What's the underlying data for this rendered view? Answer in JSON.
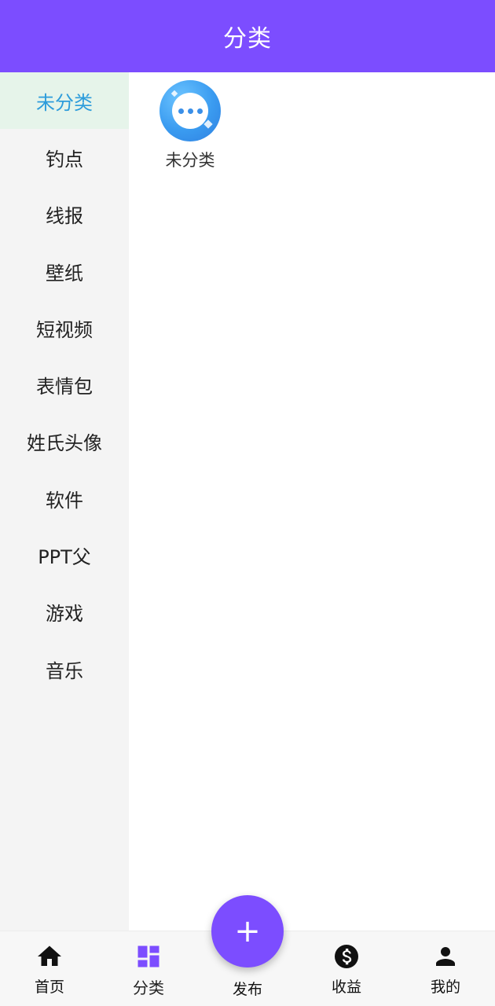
{
  "header": {
    "title": "分类"
  },
  "sidebar": {
    "items": [
      {
        "label": "未分类",
        "active": true
      },
      {
        "label": "钓点"
      },
      {
        "label": "线报"
      },
      {
        "label": "壁纸"
      },
      {
        "label": "短视频"
      },
      {
        "label": "表情包"
      },
      {
        "label": "姓氏头像"
      },
      {
        "label": "软件"
      },
      {
        "label": "PPT父"
      },
      {
        "label": "游戏"
      },
      {
        "label": "音乐"
      }
    ]
  },
  "content": {
    "categories": [
      {
        "label": "未分类",
        "icon": "more-dots-icon"
      }
    ]
  },
  "bottom_nav": {
    "home": "首页",
    "category": "分类",
    "publish": "发布",
    "earnings": "收益",
    "mine": "我的"
  },
  "colors": {
    "accent": "#7c4dff",
    "active_sidebar_bg": "#e6f4ea",
    "active_sidebar_text": "#2d9cdb"
  }
}
